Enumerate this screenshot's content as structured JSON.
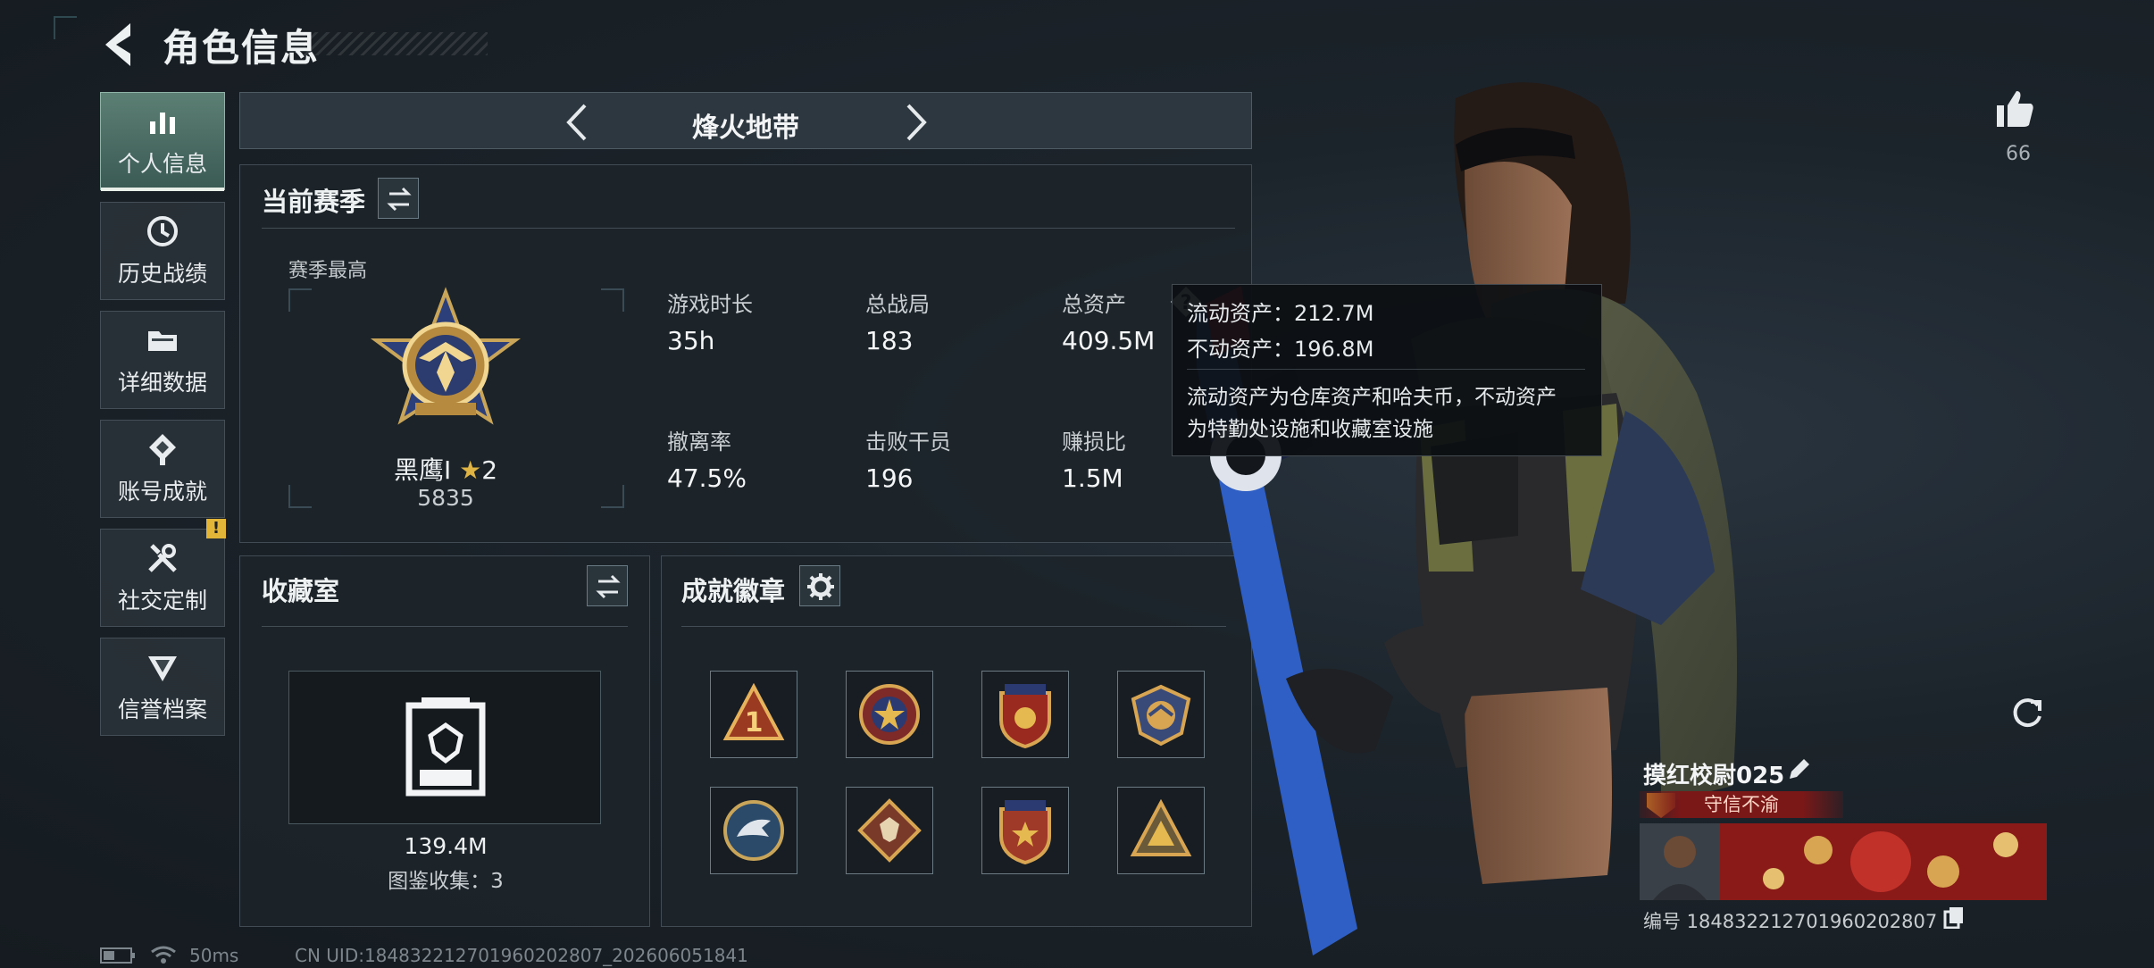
{
  "header": {
    "title": "角色信息"
  },
  "nav": {
    "items": [
      {
        "label": "个人信息",
        "icon": "bar-chart-icon",
        "active": true
      },
      {
        "label": "历史战绩",
        "icon": "history-icon",
        "active": false
      },
      {
        "label": "详细数据",
        "icon": "folder-icon",
        "active": false
      },
      {
        "label": "账号成就",
        "icon": "achievement-icon",
        "active": false
      },
      {
        "label": "社交定制",
        "icon": "tools-icon",
        "active": false,
        "badge": "!"
      },
      {
        "label": "信誉档案",
        "icon": "reputation-icon",
        "active": false
      }
    ]
  },
  "map_selector": {
    "current": "烽火地带"
  },
  "season": {
    "title": "当前赛季",
    "best_label": "赛季最高",
    "rank_name": "黑鹰Ⅰ",
    "rank_stars": "2",
    "rank_score": "5835",
    "stats": [
      {
        "label": "游戏时长",
        "value": "35h"
      },
      {
        "label": "总战局",
        "value": "183"
      },
      {
        "label": "总资产",
        "value": "409.5M"
      },
      {
        "label": "撤离率",
        "value": "47.5%"
      },
      {
        "label": "击败干员",
        "value": "196"
      },
      {
        "label": "赚损比",
        "value": "1.5M"
      }
    ]
  },
  "tooltip": {
    "line1": "流动资产：212.7M",
    "line2": "不动资产：196.8M",
    "desc1": "流动资产为仓库资产和哈夫币，不动资产",
    "desc2": "为特勤处设施和收藏室设施"
  },
  "collection": {
    "title": "收藏室",
    "value": "139.4M",
    "count_text": "图鉴收集：3"
  },
  "badges": {
    "title": "成就徽章",
    "items": [
      "rank-1-badge",
      "star-emblem-badge",
      "crest-badge",
      "eagle-shield-badge",
      "eagle-head-badge",
      "beast-diamond-badge",
      "shield-star-badge",
      "pyramid-badge"
    ]
  },
  "profile": {
    "likes": "66",
    "name": "摸红校尉025",
    "title_tag": "守信不渝",
    "id_text": "编号 1848322127019602028​07"
  },
  "status_bar": {
    "latency": "50ms",
    "uid_text": "CN UID:1848322127019602028​07_202606051841"
  }
}
